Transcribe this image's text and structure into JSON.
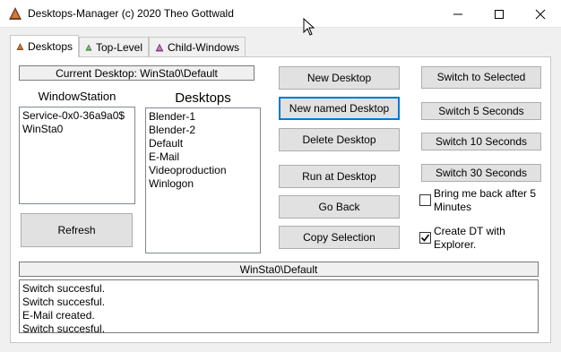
{
  "window": {
    "title": "Desktops-Manager (c) 2020 Theo Gottwald"
  },
  "tabs": [
    {
      "label": "Desktops",
      "active": true,
      "icon_color": "#a0522d"
    },
    {
      "label": "Top-Level",
      "active": false,
      "icon_color": "#3a8a3a"
    },
    {
      "label": "Child-Windows",
      "active": false,
      "icon_color": "#8a3a8a"
    }
  ],
  "current_desktop": "Current Desktop: WinSta0\\Default",
  "windowstation": {
    "label": "WindowStation",
    "items": [
      "Service-0x0-36a9a0$",
      "WinSta0"
    ]
  },
  "desktops": {
    "label": "Desktops",
    "items": [
      "Blender-1",
      "Blender-2",
      "Default",
      "E-Mail",
      "Videoproduction",
      "Winlogon"
    ]
  },
  "buttons": {
    "refresh": "Refresh",
    "new_desktop": "New Desktop",
    "new_named_desktop": "New named Desktop",
    "delete_desktop": "Delete Desktop",
    "run_at_desktop": "Run at Desktop",
    "go_back": "Go Back",
    "copy_selection": "Copy Selection",
    "switch_to_selected": "Switch to Selected",
    "switch_5": "Switch 5 Seconds",
    "switch_10": "Switch 10 Seconds",
    "switch_30": "Switch 30 Seconds"
  },
  "checkboxes": {
    "bring_back": {
      "label": "Bring me back after 5 Minutes",
      "checked": false
    },
    "create_dt": {
      "label": "Create DT with Explorer.",
      "checked": true
    }
  },
  "status_path": "WinSta0\\Default",
  "log": [
    "Switch succesful.",
    "Switch succesful.",
    "E-Mail created.",
    "Switch succesful."
  ]
}
